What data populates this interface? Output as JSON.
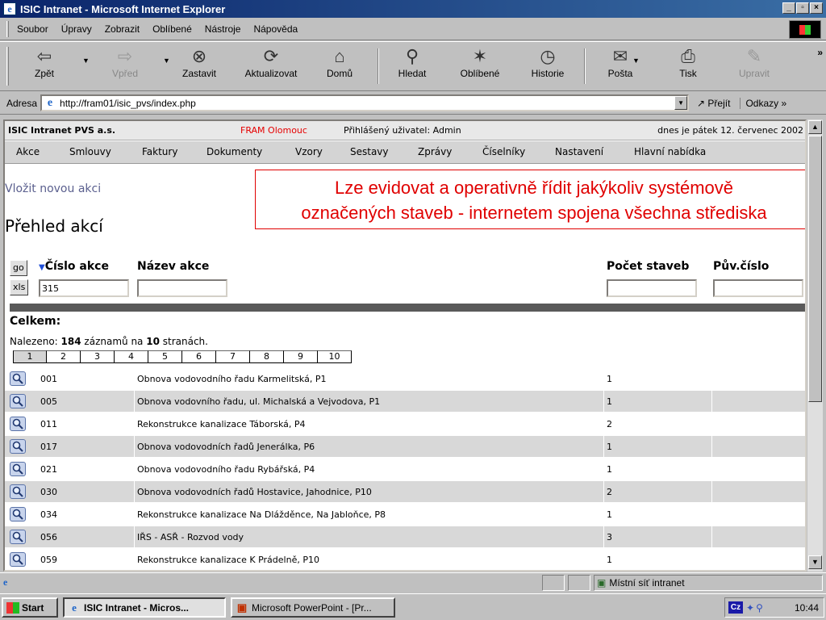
{
  "window": {
    "title": "ISIC Intranet - Microsoft Internet Explorer",
    "controls": [
      "_",
      "▫",
      "×"
    ]
  },
  "menu": [
    "Soubor",
    "Úpravy",
    "Zobrazit",
    "Oblíbené",
    "Nástroje",
    "Nápověda"
  ],
  "toolbar": {
    "buttons": [
      {
        "label": "Zpět",
        "icon": "back-arrow-icon",
        "glyph": "⇦",
        "disabled": false
      },
      {
        "label": "Vpřed",
        "icon": "forward-arrow-icon",
        "glyph": "⇨",
        "disabled": true
      },
      {
        "label": "Zastavit",
        "icon": "stop-icon",
        "glyph": "⊗",
        "disabled": false
      },
      {
        "label": "Aktualizovat",
        "icon": "refresh-icon",
        "glyph": "⟳",
        "disabled": false
      },
      {
        "label": "Domů",
        "icon": "home-icon",
        "glyph": "⌂",
        "disabled": false
      },
      {
        "label": "Hledat",
        "icon": "search-icon",
        "glyph": "⚲",
        "disabled": false
      },
      {
        "label": "Oblíbené",
        "icon": "favorites-icon",
        "glyph": "✶",
        "disabled": false
      },
      {
        "label": "Historie",
        "icon": "history-icon",
        "glyph": "◷",
        "disabled": false
      },
      {
        "label": "Pošta",
        "icon": "mail-icon",
        "glyph": "✉",
        "disabled": false
      },
      {
        "label": "Tisk",
        "icon": "print-icon",
        "glyph": "⎙",
        "disabled": false
      },
      {
        "label": "Upravit",
        "icon": "edit-icon",
        "glyph": "✎",
        "disabled": true
      }
    ],
    "more": "»"
  },
  "address": {
    "label": "Adresa",
    "url": "http://fram01/isic_pvs/index.php",
    "go_label": "Přejít",
    "links_label": "Odkazy »"
  },
  "page": {
    "company": "ISIC Intranet PVS a.s.",
    "brand": "FRAM Olomouc",
    "user": "Přihlášený uživatel: Admin",
    "date": "dnes je pátek 12. červenec 2002",
    "nav": [
      "Akce",
      "Smlouvy",
      "Faktury",
      "Dokumenty",
      "Vzory",
      "Sestavy",
      "Zprávy",
      "Číselníky",
      "Nastavení",
      "Hlavní nabídka"
    ],
    "new_link": "Vložit novou akci",
    "title": "Přehled akcí",
    "callout_line1": "Lze evidovat a operativně řídit jakýkoliv systémově",
    "callout_line2": "označených staveb - internetem spojena všechna střediska",
    "filter": {
      "go_label": "go",
      "xls_label": "xls",
      "col_number": "Číslo akce",
      "col_name": "Název akce",
      "col_count": "Počet staveb",
      "col_orig": "Pův.číslo",
      "number_value": "315",
      "name_value": "",
      "count_value": "",
      "orig_value": ""
    },
    "summary_label": "Celkem:",
    "found_prefix": "Nalezeno: ",
    "found_count": "184",
    "found_mid": " záznamů na ",
    "found_pages": "10",
    "found_suffix": " stranách.",
    "pages": [
      "1",
      "2",
      "3",
      "4",
      "5",
      "6",
      "7",
      "8",
      "9",
      "10"
    ],
    "current_page": "1",
    "rows": [
      {
        "num": "001",
        "name": "Obnova vodovodního řadu Karmelitská, P1",
        "count": "1"
      },
      {
        "num": "005",
        "name": "Obnova vodovního řadu, ul. Michalská a Vejvodova, P1",
        "count": "1"
      },
      {
        "num": "011",
        "name": "Rekonstrukce kanalizace Táborská, P4",
        "count": "2"
      },
      {
        "num": "017",
        "name": "Obnova vodovodních řadů Jenerálka, P6",
        "count": "1"
      },
      {
        "num": "021",
        "name": "Obnova vodovodního řadu Rybářská, P4",
        "count": "1"
      },
      {
        "num": "030",
        "name": "Obnova vodovodních řadů Hostavice, Jahodnice, P10",
        "count": "2"
      },
      {
        "num": "034",
        "name": "Rekonstrukce kanalizace Na Dlážděnce, Na Jabloňce, P8",
        "count": "1"
      },
      {
        "num": "056",
        "name": "IŘS - ASŘ - Rozvod vody",
        "count": "3"
      },
      {
        "num": "059",
        "name": "Rekonstrukce kanalizace K Prádelně, P10",
        "count": "1"
      }
    ]
  },
  "status": {
    "zone": "Místní síť intranet"
  },
  "taskbar": {
    "start": "Start",
    "tasks": [
      {
        "label": "ISIC Intranet - Micros...",
        "active": true
      },
      {
        "label": "Microsoft PowerPoint - [Pr...",
        "active": false
      }
    ],
    "lang": "Cz",
    "clock": "10:44"
  },
  "colors": {
    "title_gradient_start": "#0a246a",
    "callout_red": "#e00000",
    "brand_red": "#e60000",
    "link_purple": "#5a5f8e",
    "sort_blue": "#1f4fd8"
  }
}
